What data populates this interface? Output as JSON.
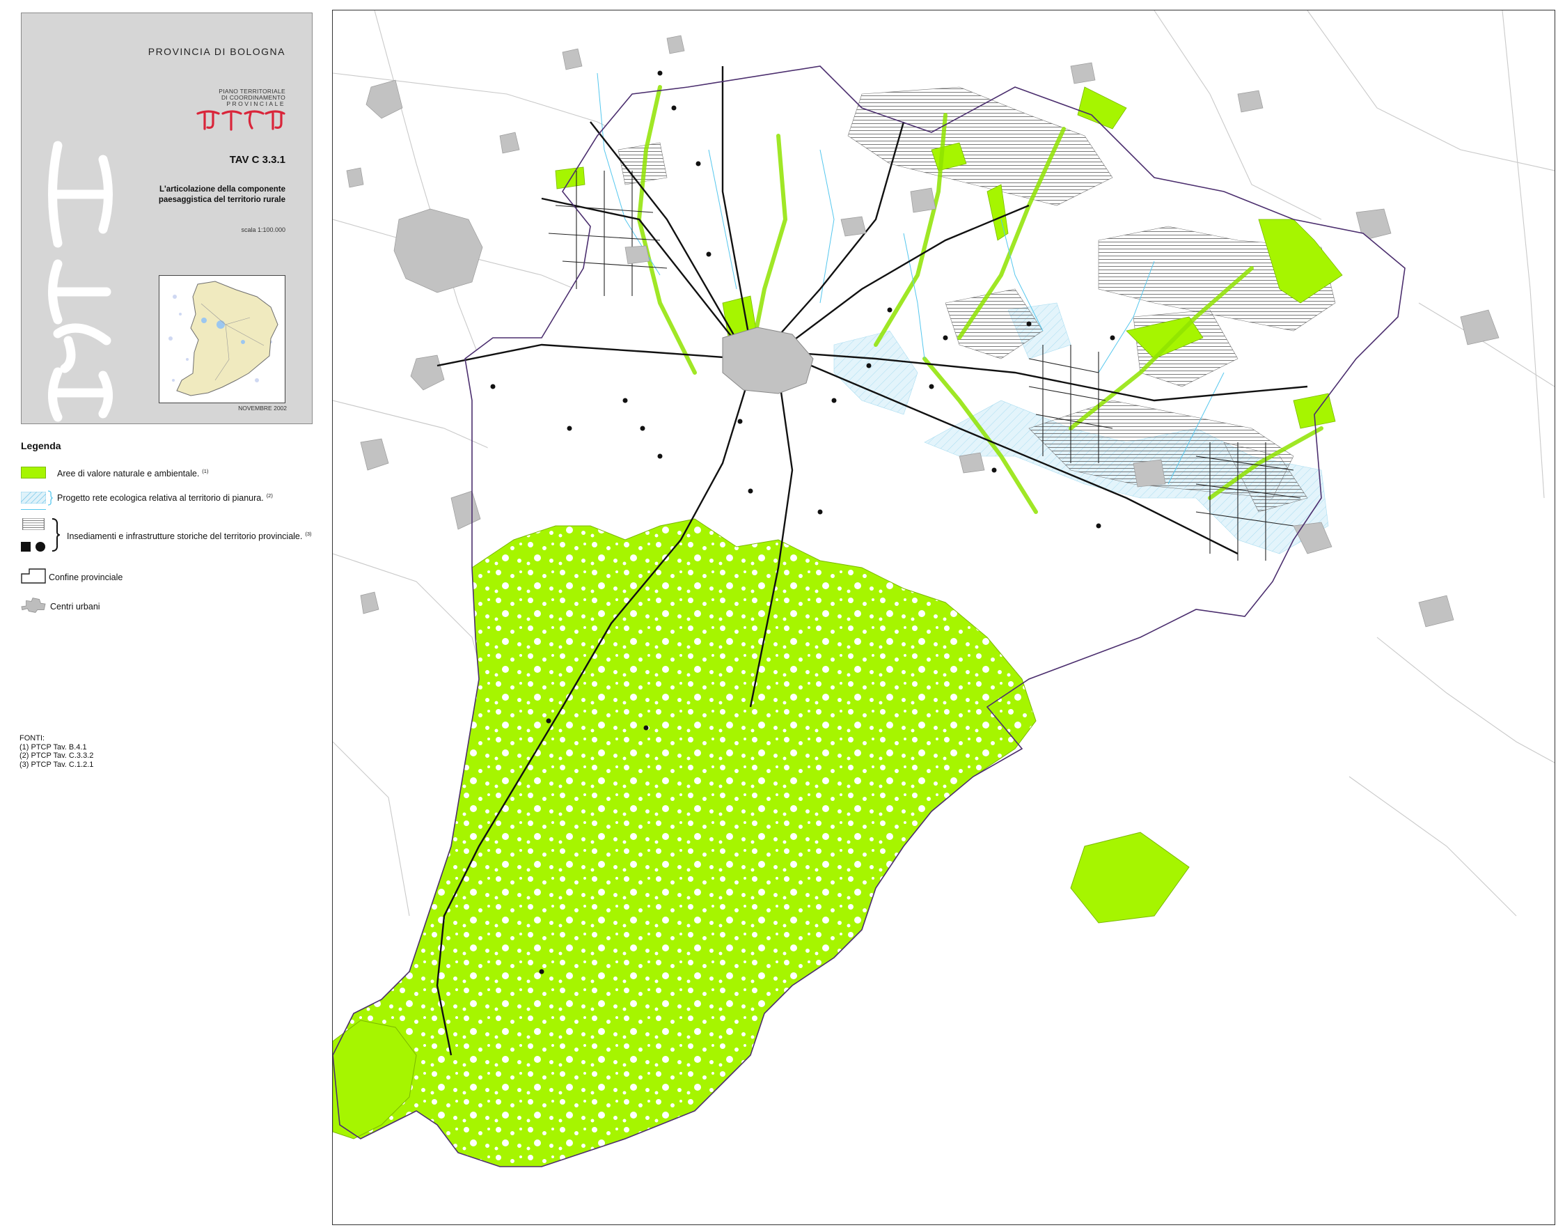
{
  "cartouche": {
    "province": "PROVINCIA DI BOLOGNA",
    "plan_name_lines": [
      "PIANO TERRITORIALE",
      "DI COORDINAMENTO",
      "PROVINCIALE"
    ],
    "logo_text": "PTCP",
    "sheet_code": "TAV C 3.3.1",
    "subtitle_lines": [
      "L'articolazione della componente",
      "paesaggistica del territorio rurale"
    ],
    "scale": "scala 1:100.000",
    "date": "NOVEMBRE 2002"
  },
  "legend": {
    "title": "Legenda",
    "items": [
      {
        "label": "Aree di valore naturale e ambientale.",
        "note": "(1)",
        "symbol": "green-area-swatch"
      },
      {
        "label": "Progetto rete ecologica relativa al territorio di pianura.",
        "note": "(2)",
        "symbol": "blue-hatch-swatch"
      },
      {
        "label": "Insediamenti e infrastrutture storiche del territorio provinciale.",
        "note": "(3)",
        "symbol": "historic-hatch-square-dot"
      },
      {
        "label": "Confine provinciale",
        "note": "",
        "symbol": "province-boundary-swatch"
      },
      {
        "label": "Centri urbani",
        "note": "",
        "symbol": "urban-centre-swatch"
      }
    ]
  },
  "sources": {
    "title": "FONTI:",
    "lines": [
      "(1) PTCP Tav. B.4.1",
      "(2) PTCP Tav. C.3.3.2",
      "(3) PTCP Tav. C.1.2.1"
    ]
  },
  "colors": {
    "natural_green": "#a6f500",
    "urban_grey": "#c2c2c2",
    "ecological_blue": "#bfe8f5",
    "water_blue": "#55c7ee",
    "boundary_purple": "#4b2e6e",
    "ptcp_red": "#d9253a",
    "cartouche_grey": "#d6d6d6"
  },
  "map": {
    "area": "Provincia di Bologna",
    "layers": [
      "natural-areas",
      "ecological-network-hatch",
      "historic-settlement-hatch",
      "historic-roads",
      "historic-points",
      "urban-centres",
      "province-boundary",
      "rivers"
    ]
  }
}
